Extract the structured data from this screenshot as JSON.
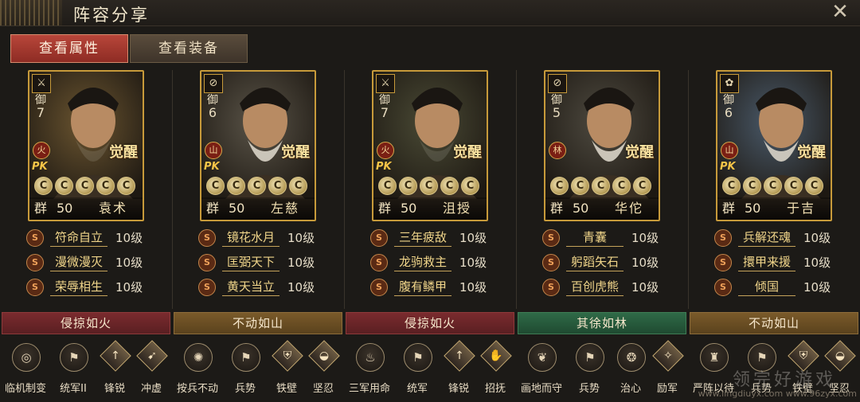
{
  "title": "阵容分享",
  "tabs": [
    {
      "label": "查看属性",
      "active": true
    },
    {
      "label": "查看装备",
      "active": false
    }
  ],
  "generals": [
    {
      "name": "袁术",
      "faction": "群",
      "level": "50",
      "defense_label": "御",
      "defense_value": "7",
      "element": "火",
      "pk": "PK",
      "awaken": "觉醒",
      "stars": [
        "C",
        "C",
        "C",
        "C",
        "C"
      ],
      "weapon_icon": "crossed-swords-icon",
      "portrait_color": "#6b5530",
      "skills": [
        {
          "badge": "S",
          "name": "符命自立",
          "level": "10级"
        },
        {
          "badge": "S",
          "name": "漫微漫灭",
          "level": "10级"
        },
        {
          "badge": "S",
          "name": "荣辱相生",
          "level": "10级"
        }
      ],
      "formation": {
        "title": "侵掠如火",
        "style": "red",
        "items": [
          {
            "label": "临机制变",
            "icon": "spiral-icon",
            "shape": "ring"
          },
          {
            "label": "统军II",
            "icon": "banner-icon",
            "shape": "ring"
          },
          {
            "label": "锋锐",
            "icon": "spear-icon",
            "shape": "diamond"
          },
          {
            "label": "冲虚",
            "icon": "arrow-icon",
            "shape": "diamond"
          }
        ]
      }
    },
    {
      "name": "左慈",
      "faction": "群",
      "level": "50",
      "defense_label": "御",
      "defense_value": "6",
      "element": "山",
      "pk": "PK",
      "awaken": "觉醒",
      "stars": [
        "C",
        "C",
        "C",
        "C",
        "C"
      ],
      "weapon_icon": "no-weapon-icon",
      "portrait_color": "#5a5448",
      "skills": [
        {
          "badge": "S",
          "name": "镜花水月",
          "level": "10级"
        },
        {
          "badge": "S",
          "name": "匡弼天下",
          "level": "10级"
        },
        {
          "badge": "S",
          "name": "黄天当立",
          "level": "10级"
        }
      ],
      "formation": {
        "title": "不动如山",
        "style": "gold",
        "items": [
          {
            "label": "按兵不动",
            "icon": "gear-icon",
            "shape": "ring"
          },
          {
            "label": "兵势",
            "icon": "banner-icon",
            "shape": "ring"
          },
          {
            "label": "铁壁",
            "icon": "shield-icon",
            "shape": "diamond"
          },
          {
            "label": "坚忍",
            "icon": "helmet-icon",
            "shape": "diamond"
          }
        ]
      }
    },
    {
      "name": "沮授",
      "faction": "群",
      "level": "50",
      "defense_label": "御",
      "defense_value": "7",
      "element": "火",
      "pk": "PK",
      "awaken": "觉醒",
      "stars": [
        "C",
        "C",
        "C",
        "C",
        "C"
      ],
      "weapon_icon": "crossed-swords-icon",
      "portrait_color": "#4a4a35",
      "skills": [
        {
          "badge": "S",
          "name": "三年疲敌",
          "level": "10级"
        },
        {
          "badge": "S",
          "name": "龙驹救主",
          "level": "10级"
        },
        {
          "badge": "S",
          "name": "腹有鳞甲",
          "level": "10级"
        }
      ],
      "formation": {
        "title": "侵掠如火",
        "style": "red",
        "items": [
          {
            "label": "三军用命",
            "icon": "flame-icon",
            "shape": "ring"
          },
          {
            "label": "统军",
            "icon": "banner-icon",
            "shape": "ring"
          },
          {
            "label": "锋锐",
            "icon": "spear-icon",
            "shape": "diamond"
          },
          {
            "label": "招抚",
            "icon": "hand-icon",
            "shape": "diamond"
          }
        ]
      }
    },
    {
      "name": "华佗",
      "faction": "群",
      "level": "50",
      "defense_label": "御",
      "defense_value": "5",
      "element": "林",
      "pk": "",
      "awaken": "觉醒",
      "stars": [
        "C",
        "C",
        "C",
        "C",
        "C"
      ],
      "weapon_icon": "no-weapon-icon",
      "portrait_color": "#4e4a40",
      "skills": [
        {
          "badge": "S",
          "name": "青囊",
          "level": "10级"
        },
        {
          "badge": "S",
          "name": "躬蹈矢石",
          "level": "10级"
        },
        {
          "badge": "S",
          "name": "百创虎熊",
          "level": "10级"
        }
      ],
      "formation": {
        "title": "其徐如林",
        "style": "green",
        "items": [
          {
            "label": "画地而守",
            "icon": "leaf-icon",
            "shape": "ring"
          },
          {
            "label": "兵势",
            "icon": "banner-icon",
            "shape": "ring"
          },
          {
            "label": "治心",
            "icon": "swirl-icon",
            "shape": "ring"
          },
          {
            "label": "励军",
            "icon": "horn-icon",
            "shape": "diamond"
          }
        ]
      }
    },
    {
      "name": "于吉",
      "faction": "群",
      "level": "50",
      "defense_label": "御",
      "defense_value": "6",
      "element": "山",
      "pk": "PK",
      "awaken": "觉醒",
      "stars": [
        "C",
        "C",
        "C",
        "C",
        "C"
      ],
      "weapon_icon": "flower-icon",
      "portrait_color": "#4a5a6a",
      "skills": [
        {
          "badge": "S",
          "name": "兵解还魂",
          "level": "10级"
        },
        {
          "badge": "S",
          "name": "擐甲来援",
          "level": "10级"
        },
        {
          "badge": "S",
          "name": "倾国",
          "level": "10级"
        }
      ],
      "formation": {
        "title": "不动如山",
        "style": "gold",
        "items": [
          {
            "label": "严阵以待",
            "icon": "soldier-icon",
            "shape": "ring"
          },
          {
            "label": "兵势",
            "icon": "banner-icon",
            "shape": "ring"
          },
          {
            "label": "铁壁",
            "icon": "shield-icon",
            "shape": "diamond"
          },
          {
            "label": "坚忍",
            "icon": "helmet-icon",
            "shape": "diamond"
          }
        ]
      }
    }
  ],
  "watermark": "www.lingdiuyx.com www.96zyx.com",
  "watermark_big": "领完好游戏"
}
